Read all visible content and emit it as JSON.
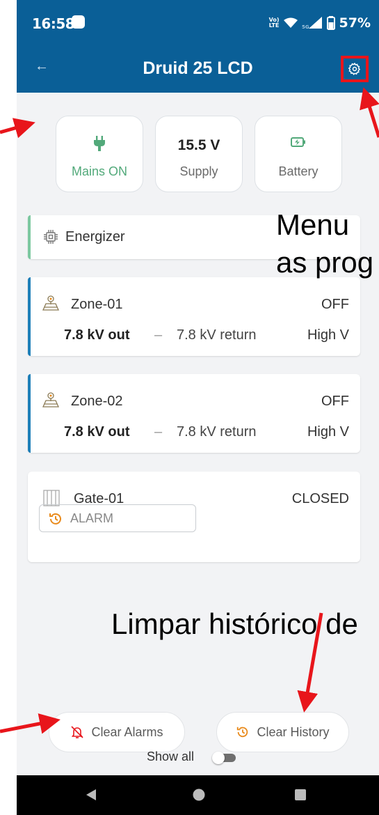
{
  "status_bar": {
    "time": "16:58",
    "volte": "Vo)) LTE",
    "network": "5G",
    "battery": "57%"
  },
  "app_bar": {
    "back_label": "←",
    "title": "Druid 25 LCD"
  },
  "summary": [
    {
      "icon": "plug-icon",
      "value": "",
      "label": "Mains ON",
      "color": "#52a97a"
    },
    {
      "icon": "",
      "value": "15.5 V",
      "label": "Supply",
      "color": "#6a6a6a"
    },
    {
      "icon": "battery-charging-icon",
      "value": "",
      "label": "Battery",
      "color": "#6a6a6a"
    }
  ],
  "energizer": {
    "label": "Energizer",
    "accent": "#7cc8a0"
  },
  "zones": [
    {
      "name": "Zone-01",
      "state": "OFF",
      "out": "7.8 kV out",
      "sep": "–",
      "ret": "7.8 kV return",
      "mode": "High V",
      "accent": "#1d7fb8"
    },
    {
      "name": "Zone-02",
      "state": "OFF",
      "out": "7.8 kV out",
      "sep": "–",
      "ret": "7.8 kV return",
      "mode": "High V",
      "accent": "#1d7fb8"
    }
  ],
  "gate": {
    "name": "Gate-01",
    "state": "CLOSED",
    "alarm_label": "ALARM"
  },
  "buttons": {
    "clear_alarms": "Clear Alarms",
    "clear_history": "Clear History"
  },
  "show_all": {
    "label": "Show all",
    "enabled": false
  },
  "annotations": {
    "menu_line1": "Menu",
    "menu_line2": "as prog",
    "history": "Limpar histórico de"
  },
  "colors": {
    "primary": "#0a5f97",
    "highlight": "#e8151b",
    "green": "#52a97a",
    "orange": "#e98a1b"
  }
}
